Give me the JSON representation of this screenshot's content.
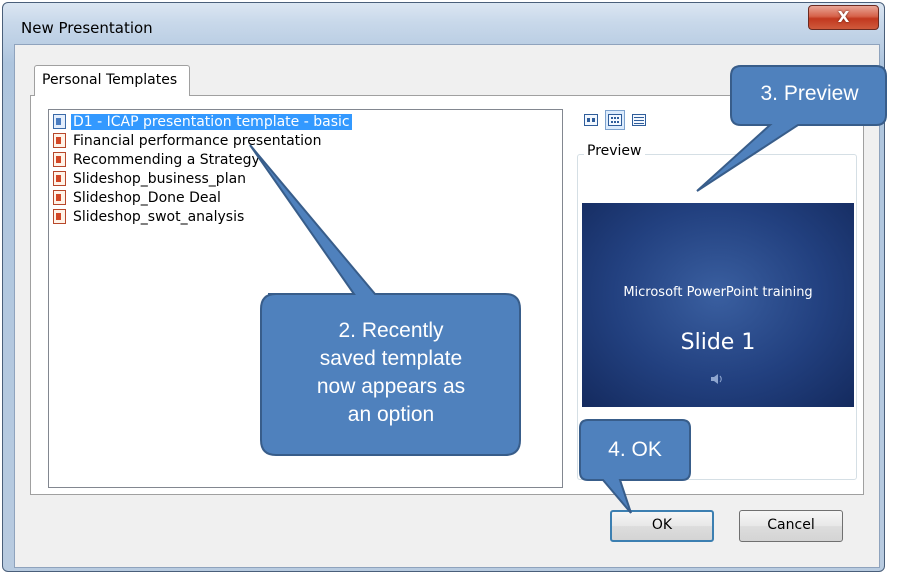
{
  "window": {
    "title": "New Presentation",
    "close_glyph": "X",
    "close_icon": "close-icon"
  },
  "tabs": [
    {
      "label": "Personal Templates",
      "selected": true
    }
  ],
  "templates": [
    {
      "name": "D1 - ICAP presentation template - basic",
      "selected": true,
      "icon": "template-icon"
    },
    {
      "name": "Financial performance presentation",
      "selected": false,
      "icon": "presentation-icon"
    },
    {
      "name": "Recommending a Strategy",
      "selected": false,
      "icon": "presentation-icon"
    },
    {
      "name": "Slideshop_business_plan",
      "selected": false,
      "icon": "presentation-icon"
    },
    {
      "name": "Slideshop_Done Deal",
      "selected": false,
      "icon": "presentation-icon"
    },
    {
      "name": "Slideshop_swot_analysis",
      "selected": false,
      "icon": "presentation-icon"
    }
  ],
  "view_buttons": [
    {
      "name": "large-icons-view-icon",
      "active": false
    },
    {
      "name": "list-view-icon",
      "active": true
    },
    {
      "name": "details-view-icon",
      "active": false
    }
  ],
  "preview": {
    "label": "Preview",
    "slide_subtitle": "Microsoft PowerPoint training",
    "slide_title": "Slide 1",
    "slide_icon": "speaker-icon"
  },
  "buttons": {
    "ok": "OK",
    "cancel": "Cancel"
  },
  "callouts": {
    "template": [
      "2. Recently",
      "saved template",
      "now appears as",
      "an option"
    ],
    "preview": "3. Preview",
    "ok": "4. OK"
  },
  "colors": {
    "selection": "#3399ff",
    "callout_fill": "#4f81bd",
    "callout_border": "#385d8a",
    "close_button": "#c7432a",
    "slide_background": "#22407f"
  }
}
